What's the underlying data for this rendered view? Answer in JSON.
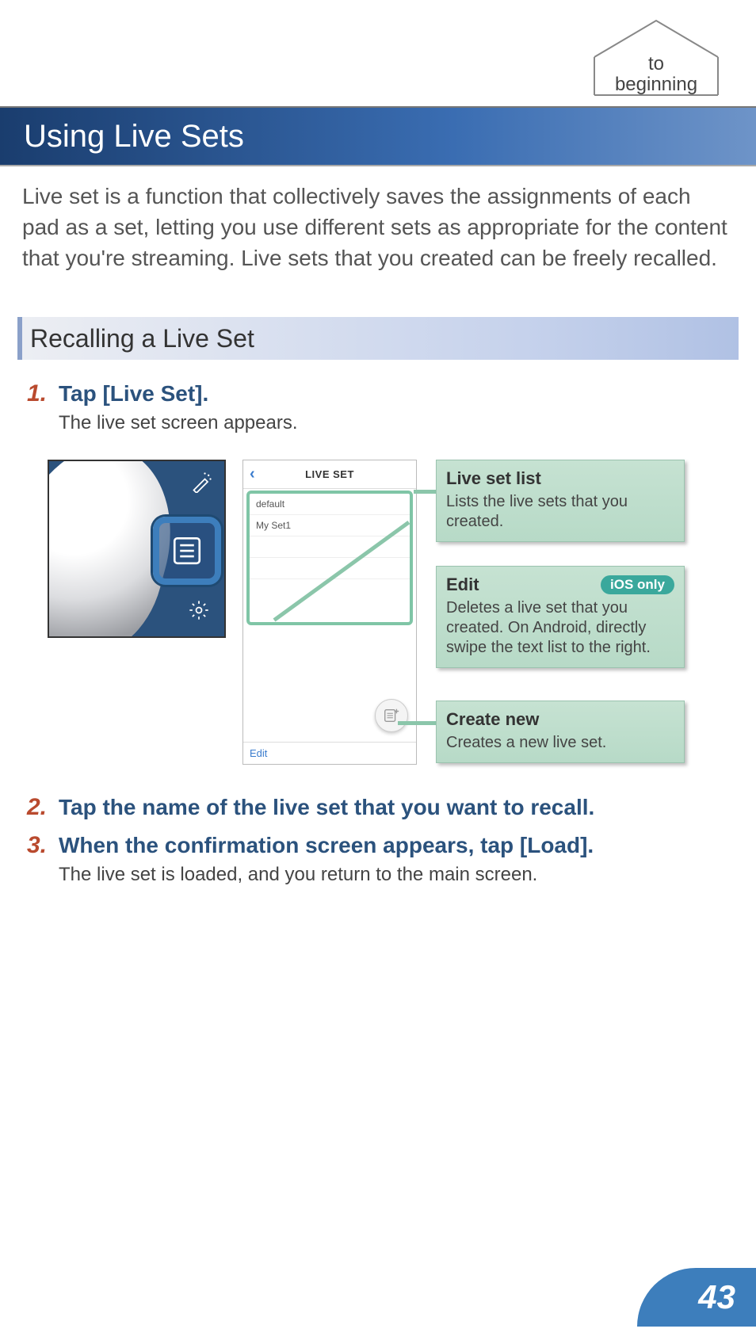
{
  "nav": {
    "to_beginning_line1": "to",
    "to_beginning_line2": "beginning"
  },
  "title": "Using Live Sets",
  "intro": "Live set is a function that collectively saves the assignments of each pad as a set, letting you use different sets as appropriate for the content that you're streaming. Live sets that you created can be freely recalled.",
  "section": "Recalling a Live Set",
  "steps": {
    "s1": {
      "num": "1.",
      "title": "Tap [Live Set].",
      "sub": "The live set screen appears."
    },
    "s2": {
      "num": "2.",
      "title": "Tap the name of the live set that you want to recall."
    },
    "s3": {
      "num": "3.",
      "title": "When the confirmation screen appears, tap [Load].",
      "sub": "The live set is loaded, and you return to the main screen."
    }
  },
  "phone": {
    "header": "LIVE SET",
    "rows": [
      "default",
      "My Set1"
    ],
    "edit": "Edit"
  },
  "callouts": {
    "list": {
      "title": "Live set list",
      "desc": "Lists the live sets that you created."
    },
    "edit": {
      "title": "Edit",
      "badge": "iOS only",
      "desc": "Deletes a live set that you created. On Android, directly swipe the text list to the right."
    },
    "create": {
      "title": "Create new",
      "desc": "Creates a new live set."
    }
  },
  "page_number": "43"
}
